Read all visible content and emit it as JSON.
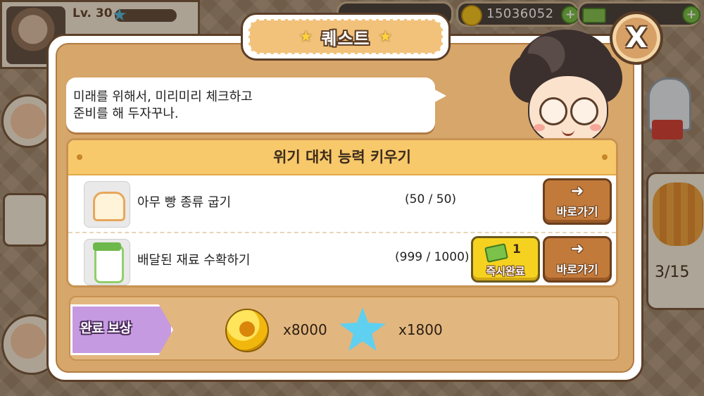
{
  "hud": {
    "level_label": "Lv. 30",
    "gold": "15036052",
    "gold_plus": "+",
    "gems": "",
    "cash": "",
    "cash_plus": "+"
  },
  "dialog": {
    "title": "퀘스트",
    "close_label": "X",
    "npc_speech": "미래를 위해서, 미리미리 체크하고\n준비를 해 두자꾸나."
  },
  "quest_group": {
    "title": "위기 대처 능력 키우기",
    "quests": [
      {
        "name": "아무 빵 종류 굽기",
        "progress": "(50 / 50)",
        "go_label": "바로가기",
        "icon": "bread-icon"
      },
      {
        "name": "배달된 재료 수확하기",
        "progress": "(999 / 1000)",
        "go_label": "바로가기",
        "icon": "flour-sack-icon",
        "instant_label": "즉시완료",
        "instant_cost": "1"
      }
    ]
  },
  "reward": {
    "label": "완료 보상",
    "gold_amount": "x8000",
    "star_amount": "x1800"
  },
  "side": {
    "tiger_count": "3/15"
  },
  "colors": {
    "dialog_bg": "#d7a66a",
    "dialog_border": "#5b3e27",
    "header_yellow": "#f7c96a",
    "go_button": "#c27a3a",
    "instant_button": "#f5d21f",
    "reward_ribbon": "#c59ae0",
    "blue_star": "#5fd0f0"
  }
}
